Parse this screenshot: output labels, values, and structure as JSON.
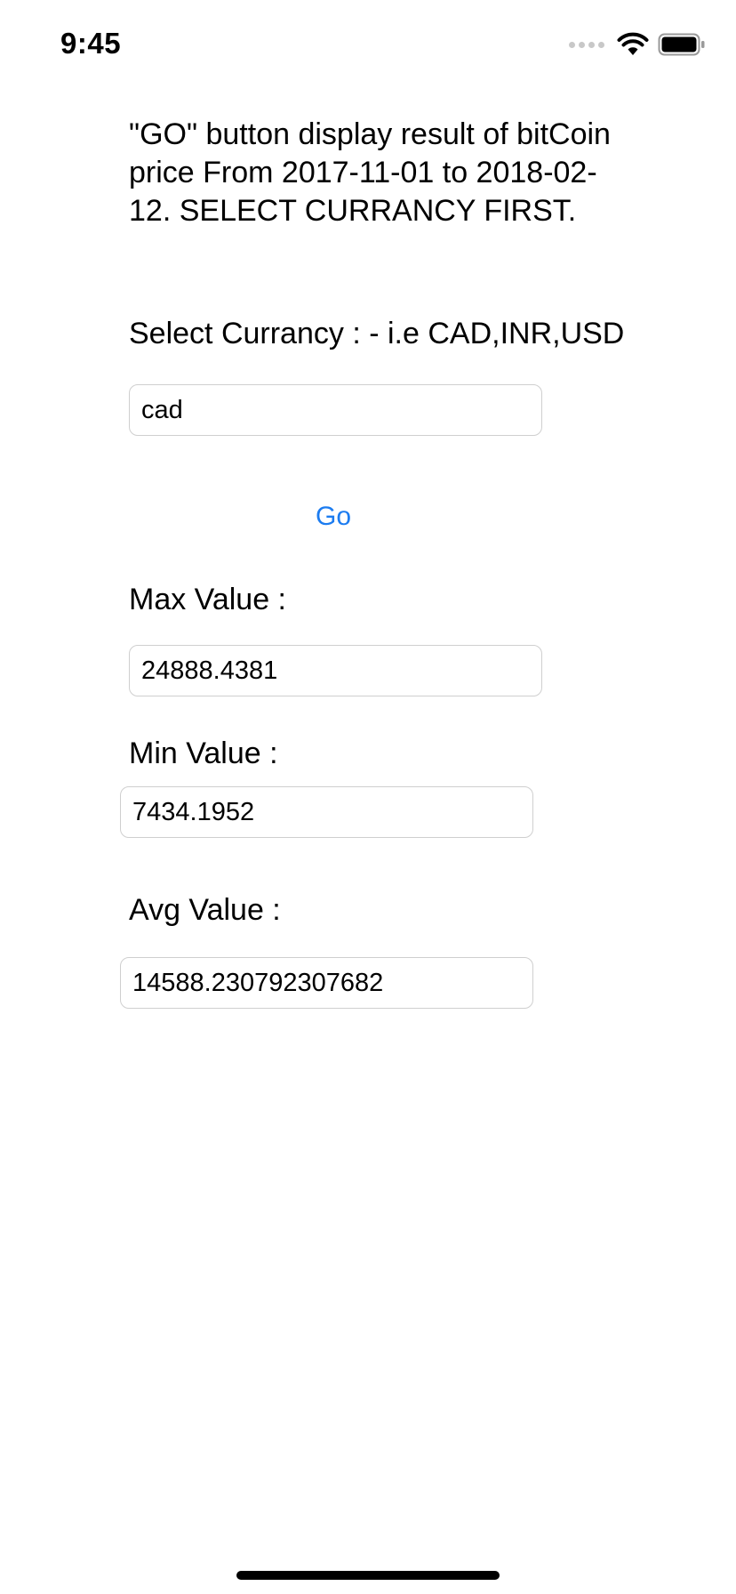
{
  "status_bar": {
    "time": "9:45",
    "icons": [
      "cellular-signal-icon",
      "wifi-icon",
      "battery-icon"
    ]
  },
  "instructions": "\"GO\" button display result of bitCoin price From 2017-11-01 to 2018-02-12. SELECT CURRANCY FIRST.",
  "currency": {
    "label": "Select Currancy : - i.e CAD,INR,USD",
    "value": "cad"
  },
  "go_button": {
    "label": "Go",
    "color": "#1c7cf0"
  },
  "max": {
    "label": "Max Value :",
    "value": "24888.4381"
  },
  "min": {
    "label": "Min Value :",
    "value": "7434.1952"
  },
  "avg": {
    "label": "Avg Value :",
    "value": "14588.230792307682"
  }
}
